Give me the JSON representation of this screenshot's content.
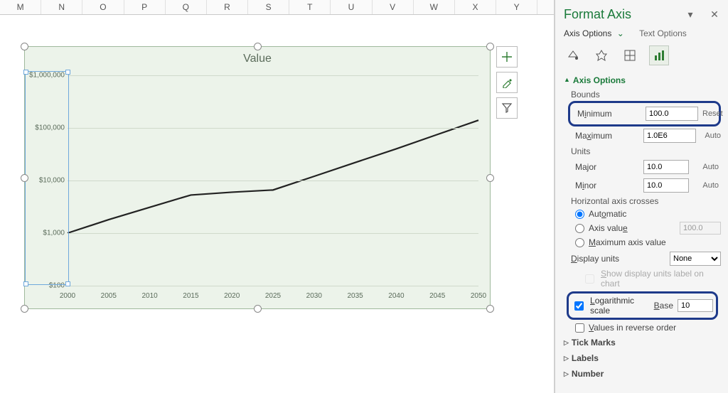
{
  "columns": [
    "M",
    "N",
    "O",
    "P",
    "Q",
    "R",
    "S",
    "T",
    "U",
    "V",
    "W",
    "X",
    "Y",
    ""
  ],
  "chart_tools": {
    "add_element_title": "Add Chart Element",
    "styles_title": "Chart Styles",
    "filters_title": "Chart Filters"
  },
  "pane": {
    "title": "Format Axis",
    "tabs": {
      "axis_options": "Axis Options",
      "text_options": "Text Options"
    },
    "section_axis_options": "Axis Options",
    "bounds_label": "Bounds",
    "minimum_label": "Minimum",
    "minimum_value": "100.0",
    "minimum_btn": "Reset",
    "maximum_label": "Maximum",
    "maximum_value": "1.0E6",
    "maximum_btn": "Auto",
    "units_label": "Units",
    "major_label": "Major",
    "major_value": "10.0",
    "major_btn": "Auto",
    "minor_label": "Minor",
    "minor_value": "10.0",
    "minor_btn": "Auto",
    "hac_label": "Horizontal axis crosses",
    "hac_auto": "Automatic",
    "hac_axis_value": "Axis value",
    "hac_axis_value_val": "100.0",
    "hac_max": "Maximum axis value",
    "display_units_label": "Display units",
    "display_units_value": "None",
    "show_du_label": "Show display units label on chart",
    "log_scale_label": "Logarithmic scale",
    "base_label": "Base",
    "base_value": "10",
    "values_reverse": "Values in reverse order",
    "tick_marks": "Tick Marks",
    "labels": "Labels",
    "number": "Number"
  },
  "chart_data": {
    "type": "line",
    "title": "Value",
    "xlabel": "",
    "ylabel": "",
    "y_scale": "log",
    "y_log_base": 10,
    "ylim": [
      100,
      1000000
    ],
    "xlim": [
      2000,
      2050
    ],
    "x": [
      2000,
      2005,
      2010,
      2015,
      2020,
      2025,
      2030,
      2035,
      2040,
      2045,
      2050
    ],
    "series": [
      {
        "name": "Value",
        "values": [
          1000,
          1800,
          3100,
          5300,
          6000,
          6600,
          12000,
          22000,
          40000,
          75000,
          140000
        ]
      }
    ],
    "y_ticks": [
      100,
      1000,
      10000,
      100000,
      1000000
    ],
    "y_tick_labels": [
      "$100",
      "$1,000",
      "$10,000",
      "$100,000",
      "$1,000,000"
    ],
    "x_ticks": [
      2000,
      2005,
      2010,
      2015,
      2020,
      2025,
      2030,
      2035,
      2040,
      2045,
      2050
    ]
  }
}
